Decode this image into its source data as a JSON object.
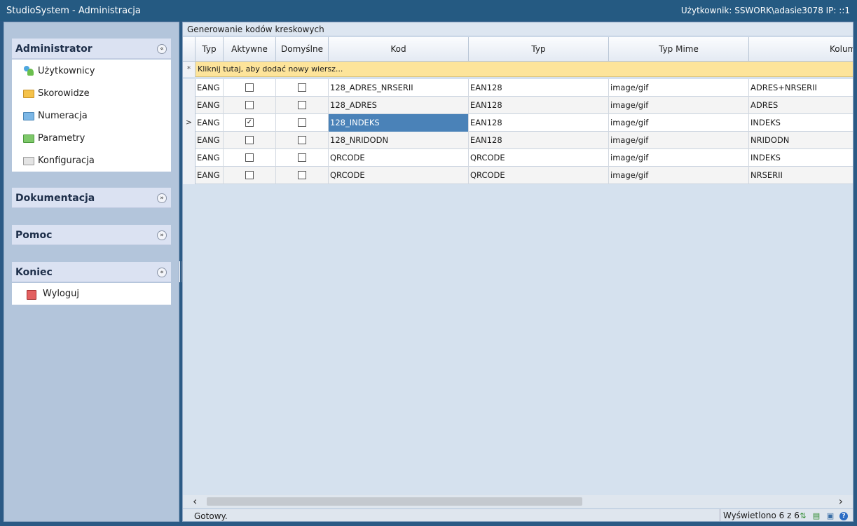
{
  "titlebar": {
    "app_title": "StudioSystem - Administracja",
    "user_info": "Użytkownik: SSWORK\\adasie3078 IP: ::1"
  },
  "sidebar": {
    "panels": [
      {
        "title": "Administrator",
        "toggle": "«",
        "items": [
          {
            "label": "Użytkownicy",
            "icon": "users-icon"
          },
          {
            "label": "Skorowidze",
            "icon": "folder-yellow-icon"
          },
          {
            "label": "Numeracja",
            "icon": "folder-blue-icon"
          },
          {
            "label": "Parametry",
            "icon": "folder-green-icon"
          },
          {
            "label": "Konfiguracja",
            "icon": "folder-gray-icon"
          }
        ]
      },
      {
        "title": "Dokumentacja",
        "toggle": "»"
      },
      {
        "title": "Pomoc",
        "toggle": "»"
      },
      {
        "title": "Koniec",
        "toggle": "«",
        "items": [
          {
            "label": "Wyloguj",
            "icon": "logout-icon"
          }
        ]
      }
    ]
  },
  "main": {
    "caption": "Generowanie kodów kreskowych",
    "columns": [
      "Typ",
      "Aktywne",
      "Domyślne",
      "Kod",
      "Typ",
      "Typ Mime",
      "Kolum"
    ],
    "new_row_text": "Kliknij tutaj, aby dodać nowy wiersz...",
    "new_row_marker": "*",
    "current_row_marker": ">",
    "rows": [
      {
        "typ": "EANG",
        "aktywne": false,
        "domyslne": false,
        "kod": "128_ADRES_NRSERII",
        "typ2": "EAN128",
        "mime": "image/gif",
        "kolumna": "ADRES+NRSERII"
      },
      {
        "typ": "EANG",
        "aktywne": false,
        "domyslne": false,
        "kod": "128_ADRES",
        "typ2": "EAN128",
        "mime": "image/gif",
        "kolumna": "ADRES"
      },
      {
        "typ": "EANG",
        "aktywne": true,
        "domyslne": false,
        "kod": "128_INDEKS",
        "typ2": "EAN128",
        "mime": "image/gif",
        "kolumna": "INDEKS",
        "selected": true
      },
      {
        "typ": "EANG",
        "aktywne": false,
        "domyslne": false,
        "kod": "128_NRIDODN",
        "typ2": "EAN128",
        "mime": "image/gif",
        "kolumna": "NRIDODN"
      },
      {
        "typ": "EANG",
        "aktywne": false,
        "domyslne": false,
        "kod": "QRCODE",
        "typ2": "QRCODE",
        "mime": "image/gif",
        "kolumna": "INDEKS"
      },
      {
        "typ": "EANG",
        "aktywne": false,
        "domyslne": false,
        "kod": "QRCODE",
        "typ2": "QRCODE",
        "mime": "image/gif",
        "kolumna": "NRSERII"
      }
    ],
    "status": {
      "ready": "Gotowy.",
      "count": "Wyświetlono 6 z 6"
    }
  },
  "colors": {
    "titlebar": "#255a82",
    "sidebar": "#b3c5db",
    "panel_header": "#dbe2f2",
    "new_row": "#fde49a",
    "selection": "#4a82b8"
  }
}
